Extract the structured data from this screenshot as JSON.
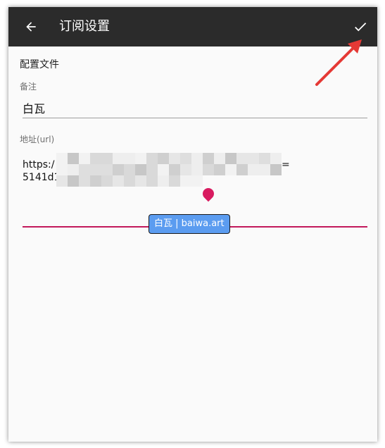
{
  "toolbar": {
    "title": "订阅设置",
    "back_icon": "arrow-left-icon",
    "confirm_icon": "check-icon",
    "background": "#2b2b2b"
  },
  "form": {
    "section_title": "配置文件",
    "remark": {
      "label": "备注",
      "value": "白瓦"
    },
    "url": {
      "label": "地址(url)",
      "line1_prefix": "https:/",
      "line1_suffix": "=",
      "line2_prefix": "5141d1",
      "accent_color": "#c2185b"
    }
  },
  "watermark": {
    "text": "白瓦 | baiwa.art",
    "background": "#5b9cf0"
  },
  "annotation": {
    "arrow_color": "#e53935"
  }
}
